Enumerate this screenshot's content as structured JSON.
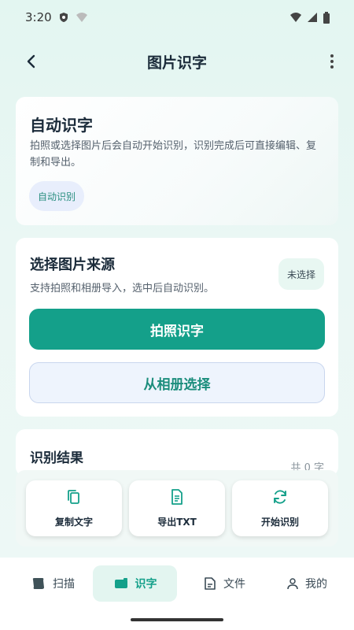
{
  "status_bar": {
    "time": "3:20"
  },
  "app_bar": {
    "title": "图片识字"
  },
  "auto_card": {
    "title": "自动识字",
    "description": "拍照或选择图片后会自动开始识别，识别完成后可直接编辑、复制和导出。",
    "chip": "自动识别"
  },
  "source_card": {
    "title": "选择图片来源",
    "description": "支持拍照和相册导入，选中后自动识别。",
    "badge": "未选择",
    "camera_button": "拍照识字",
    "gallery_button": "从相册选择"
  },
  "result_card": {
    "title": "识别结果",
    "count": "共 0 字"
  },
  "actions": [
    {
      "label": "复制文字",
      "icon": "copy-icon"
    },
    {
      "label": "导出TXT",
      "icon": "document-icon"
    },
    {
      "label": "开始识别",
      "icon": "refresh-icon"
    }
  ],
  "bottom_nav": [
    {
      "label": "扫描",
      "icon": "scan-icon"
    },
    {
      "label": "识字",
      "icon": "text-recognition-icon",
      "active": true
    },
    {
      "label": "文件",
      "icon": "file-icon"
    },
    {
      "label": "我的",
      "icon": "person-icon"
    }
  ],
  "colors": {
    "accent": "#14a08a",
    "background": "#e3f6f1"
  }
}
